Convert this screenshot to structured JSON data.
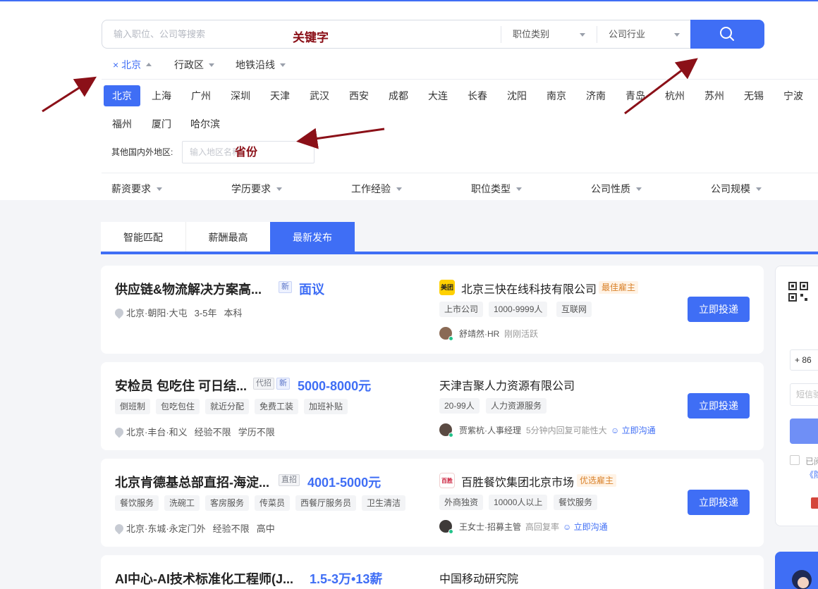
{
  "search": {
    "placeholder": "输入职位、公司等搜索",
    "annotation_keyword": "关键字",
    "category_label": "职位类别",
    "industry_label": "公司行业",
    "button_icon": "search-icon"
  },
  "filters": {
    "city_selected": "× 北京",
    "district": "行政区",
    "subway": "地铁沿线"
  },
  "cities": [
    "北京",
    "上海",
    "广州",
    "深圳",
    "天津",
    "武汉",
    "西安",
    "成都",
    "大连",
    "长春",
    "沈阳",
    "南京",
    "济南",
    "青岛",
    "杭州",
    "苏州",
    "无锡",
    "宁波",
    "福州",
    "厦门",
    "哈尔滨"
  ],
  "other_region": {
    "label": "其他国内外地区:",
    "placeholder": "输入地区名称",
    "annotation_province": "省份"
  },
  "conditions": [
    "薪资要求",
    "学历要求",
    "工作经验",
    "职位类型",
    "公司性质",
    "公司规模"
  ],
  "tabs": [
    "智能匹配",
    "薪酬最高",
    "最新发布"
  ],
  "jobs": [
    {
      "title": "供应链&物流解决方案高...",
      "badges": [
        "新"
      ],
      "salary": "面议",
      "tags": [],
      "location": "北京·朝阳·大屯",
      "experience": "3-5年",
      "education": "本科",
      "company": "北京三快在线科技有限公司",
      "company_badge": "最佳雇主",
      "company_logo": "美团",
      "company_tags": [
        "上市公司",
        "1000-9999人",
        "互联网"
      ],
      "recruiter": "舒靖然·HR",
      "status": "刚刚活跃",
      "chat": "",
      "apply": "立即投递"
    },
    {
      "title": "安检员 包吃住 可日结...",
      "badges": [
        "代招",
        "新"
      ],
      "salary": "5000-8000元",
      "tags": [
        "倒班制",
        "包吃包住",
        "就近分配",
        "免费工装",
        "加班补贴"
      ],
      "location": "北京·丰台·和义",
      "experience": "经验不限",
      "education": "学历不限",
      "company": "天津吉聚人力资源有限公司",
      "company_badge": "",
      "company_logo": "",
      "company_tags": [
        "20-99人",
        "人力资源服务"
      ],
      "recruiter": "贾紫杭·人事经理",
      "status": "5分钟内回复可能性大",
      "chat": "立即沟通",
      "apply": "立即投递"
    },
    {
      "title": "北京肯德基总部直招-海淀...",
      "badges": [
        "直招"
      ],
      "salary": "4001-5000元",
      "tags": [
        "餐饮服务",
        "洗碗工",
        "客房服务",
        "传菜员",
        "西餐厅服务员",
        "卫生清洁"
      ],
      "location": "北京·东城·永定门外",
      "experience": "经验不限",
      "education": "高中",
      "company": "百胜餐饮集团北京市场",
      "company_badge": "优选雇主",
      "company_logo": "百胜",
      "company_tags": [
        "外商独资",
        "10000人以上",
        "餐饮服务"
      ],
      "recruiter": "王女士·招募主管",
      "status": "高回复率",
      "chat": "立即沟通",
      "apply": "立即投递"
    },
    {
      "title": "AI中心-AI技术标准化工程师(J...",
      "badges": [],
      "salary": "1.5-3万•13薪",
      "tags": [],
      "location": "",
      "experience": "",
      "education": "",
      "company": "中国移动研究院",
      "company_badge": "",
      "company_logo": "",
      "company_tags": [],
      "recruiter": "",
      "status": "",
      "chat": "",
      "apply": ""
    }
  ],
  "side": {
    "phone_prefix": "+ 86",
    "sms_placeholder": "短信验",
    "agree_text": "已阅",
    "agree_link": "《隐"
  },
  "colors": {
    "accent": "#3f6ef5",
    "annotation": "#8b1018"
  }
}
